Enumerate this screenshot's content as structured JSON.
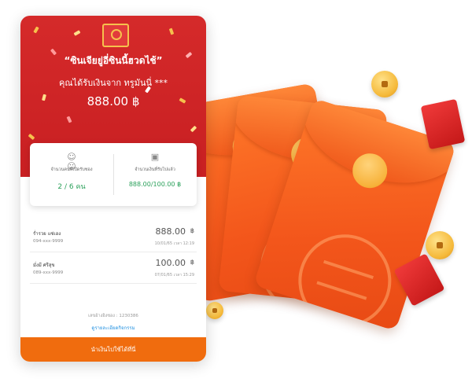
{
  "hero": {
    "greeting": "“ซินเจียยู่อี่ซินนี้ฮวดไช้”",
    "from_line": "คุณได้รับเงินจาก ทรูมันนี่ ***",
    "amount": "888.00 ฿"
  },
  "stats": {
    "people_label": "จำนวนคนที่เปิดรับซอง",
    "people_value": "2 / 6 คน",
    "money_label": "จำนวนเงินที่รับไปแล้ว",
    "money_value": "888.00/100.00 ฿"
  },
  "recipients": [
    {
      "name": "ร่ำรวย แซ่เฮง",
      "phone": "094-xxx-9999",
      "amount": "888.00",
      "currency": "฿",
      "time": "10/01/65 เวลา 12:19"
    },
    {
      "name": "มั่งมี ศรีสุข",
      "phone": "089-xxx-9999",
      "amount": "100.00",
      "currency": "฿",
      "time": "07/01/65 เวลา 15:29"
    }
  ],
  "footer": {
    "reference": "เลขอ้างอิงซอง : 1230386",
    "details_link": "ดูรายละเอียดกิจกรรม",
    "cta": "นำเงินไปใช้ได้ที่นี่"
  },
  "colors": {
    "hero_red": "#c81f22",
    "accent_orange": "#f06c0e",
    "value_green": "#2aa05a",
    "link_blue": "#1e8fe0"
  }
}
